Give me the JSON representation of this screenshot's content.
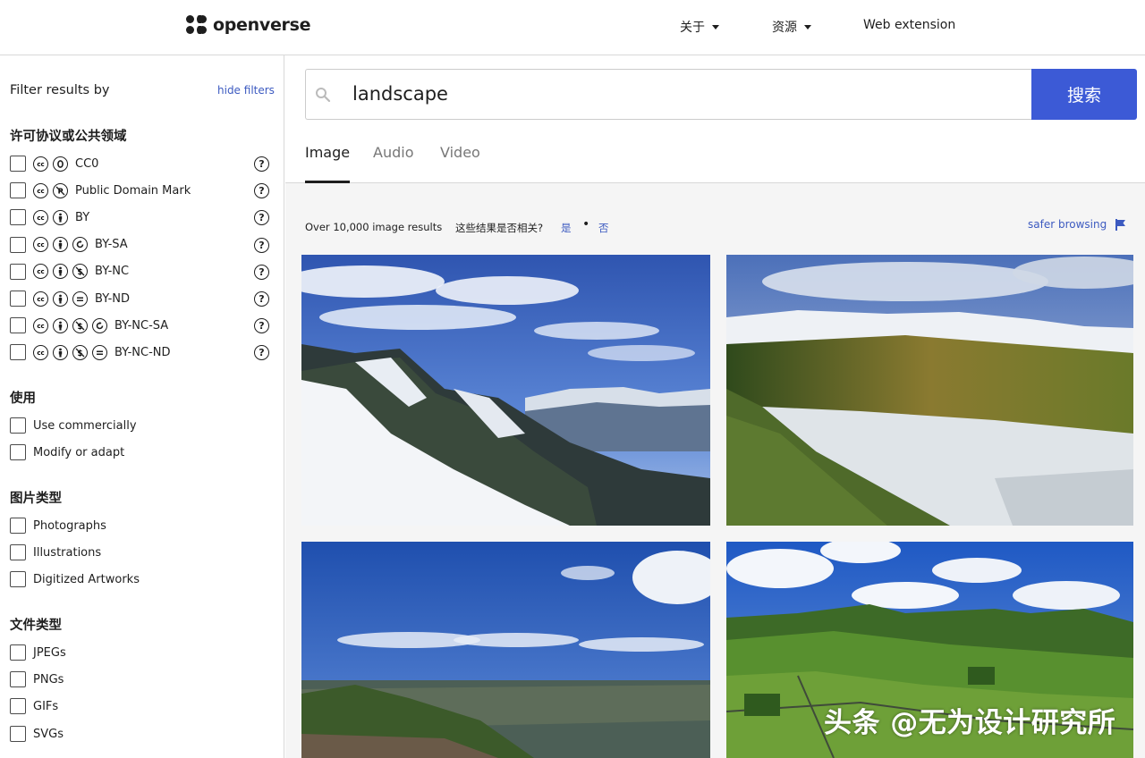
{
  "header": {
    "brand": "openverse",
    "nav": [
      {
        "label": "关于",
        "has_caret": true
      },
      {
        "label": "资源",
        "has_caret": true
      },
      {
        "label": "Web extension",
        "has_caret": false
      }
    ]
  },
  "sidebar": {
    "title": "Filter results by",
    "hide_filters": "hide filters",
    "license_section": "许可协议或公共领域",
    "licenses": [
      {
        "label": "CC0",
        "icons": [
          "cc-icon",
          "zero-icon"
        ]
      },
      {
        "label": "Public Domain Mark",
        "icons": [
          "cc-icon",
          "pd-icon"
        ]
      },
      {
        "label": "BY",
        "icons": [
          "cc-icon",
          "by-icon"
        ]
      },
      {
        "label": "BY-SA",
        "icons": [
          "cc-icon",
          "by-icon",
          "sa-icon"
        ]
      },
      {
        "label": "BY-NC",
        "icons": [
          "cc-icon",
          "by-icon",
          "nc-icon"
        ]
      },
      {
        "label": "BY-ND",
        "icons": [
          "cc-icon",
          "by-icon",
          "nd-icon"
        ]
      },
      {
        "label": "BY-NC-SA",
        "icons": [
          "cc-icon",
          "by-icon",
          "nc-icon",
          "sa-icon"
        ]
      },
      {
        "label": "BY-NC-ND",
        "icons": [
          "cc-icon",
          "by-icon",
          "nc-icon",
          "nd-icon"
        ]
      }
    ],
    "use_section": "使用",
    "use": [
      "Use commercially",
      "Modify or adapt"
    ],
    "image_type_section": "图片类型",
    "image_types": [
      "Photographs",
      "Illustrations",
      "Digitized Artworks"
    ],
    "file_type_section": "文件类型",
    "file_types": [
      "JPEGs",
      "PNGs",
      "GIFs",
      "SVGs"
    ],
    "help_glyph": "?"
  },
  "search": {
    "value": "landscape",
    "button": "搜索"
  },
  "tabs": [
    "Image",
    "Audio",
    "Video"
  ],
  "active_tab": "Image",
  "results": {
    "count": "Over 10,000 image results",
    "relevant_question": "这些结果是否相关?",
    "yes": "是",
    "separator": "•",
    "no": "否",
    "safer_browsing": "safer browsing"
  },
  "images": [
    {
      "name": "snowy-mountain-ridge"
    },
    {
      "name": "snowy-valley-autumn"
    },
    {
      "name": "blue-sky-plain"
    },
    {
      "name": "green-hills-walls"
    }
  ],
  "watermark": "头条 @无为设计研究所",
  "colors": {
    "accent": "#3c5ad6",
    "link": "#3c5ac0",
    "results_bg": "#f5f5f5"
  }
}
